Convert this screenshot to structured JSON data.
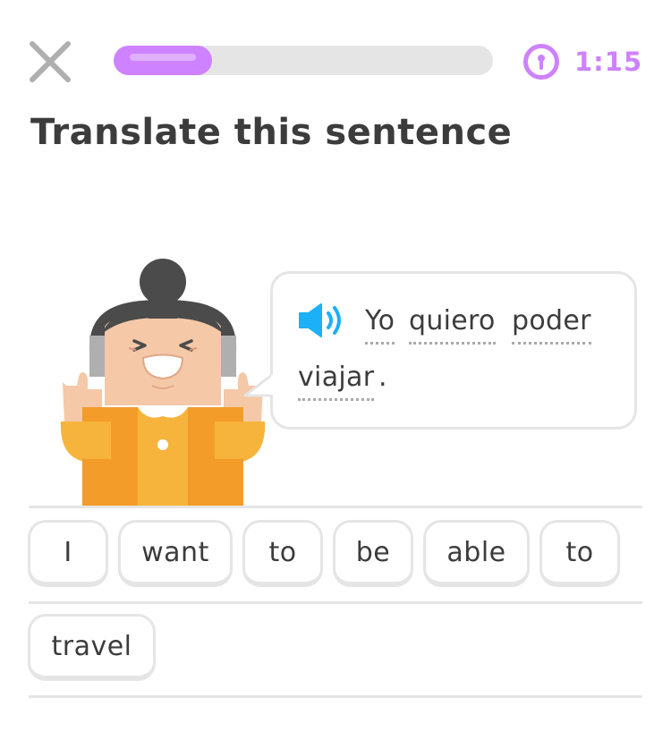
{
  "header": {
    "close_icon": "close-icon",
    "progress": 0.26,
    "timer_icon": "timer-icon",
    "timer": "1:15",
    "accent_color": "#ce82ff"
  },
  "title": "Translate this sentence",
  "prompt": {
    "speaker_icon": "speaker-icon",
    "words": [
      "Yo",
      "quiero",
      "poder",
      "viajar"
    ],
    "punctuation": "."
  },
  "answer_words": [
    "I",
    "want",
    "to",
    "be",
    "able",
    "to",
    "travel"
  ]
}
